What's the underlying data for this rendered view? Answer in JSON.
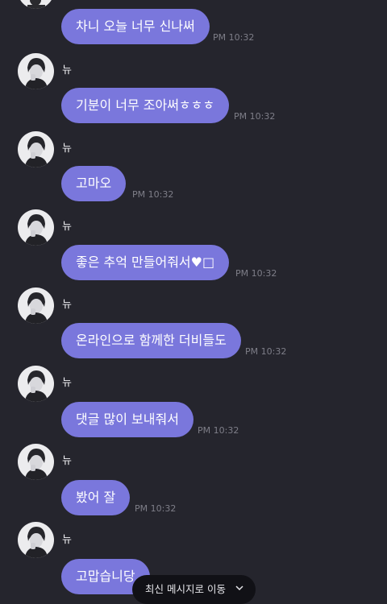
{
  "sender": "뉴",
  "messages": [
    {
      "text": "차니 오늘 너무 신나써",
      "time": "PM 10:32"
    },
    {
      "text": "기분이 너무 조아써ㅎㅎㅎ",
      "time": "PM 10:32"
    },
    {
      "text": "고마오",
      "time": "PM 10:32"
    },
    {
      "text": "좋은 추억 만들어줘서♥□",
      "time": "PM 10:32"
    },
    {
      "text": "온라인으로 함께한 더비들도",
      "time": "PM 10:32"
    },
    {
      "text": "댓글 많이 보내줘서",
      "time": "PM 10:32"
    },
    {
      "text": "봤어 잘",
      "time": "PM 10:32"
    },
    {
      "text": "고맙습니당",
      "time": ""
    }
  ],
  "jump_button": {
    "label": "최신 메시지로 이동",
    "icon": "chevron-down-icon"
  },
  "colors": {
    "background": "#25252d",
    "bubble": "#7a77dc",
    "timestamp": "#7e7e88"
  }
}
